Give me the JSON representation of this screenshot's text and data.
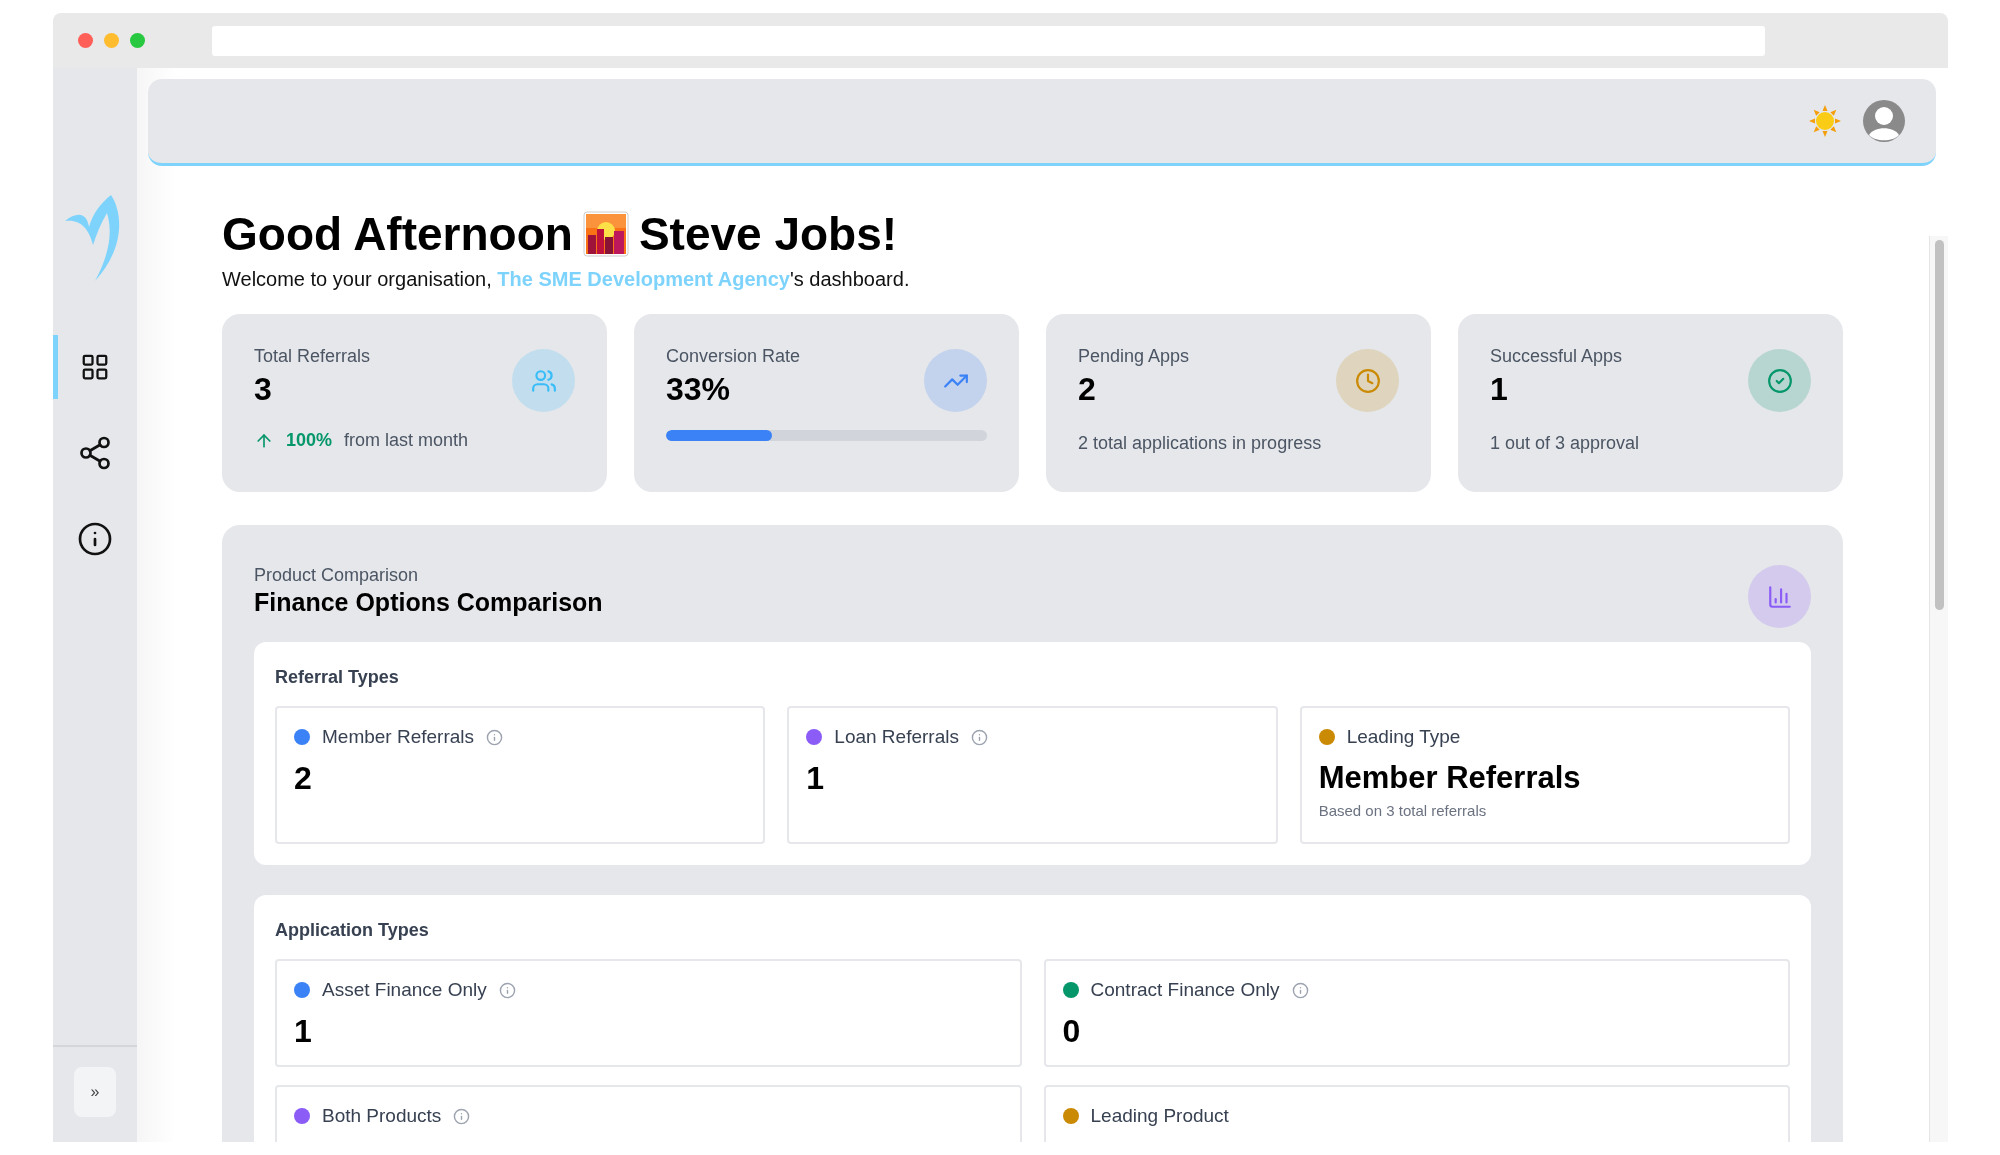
{
  "sidebar": {
    "items": [
      {
        "kind": "grid",
        "selected": true
      },
      {
        "kind": "share",
        "selected": false
      },
      {
        "kind": "info",
        "selected": false
      }
    ],
    "expand_button": "»"
  },
  "greeting": {
    "before": "Good Afternoon",
    "after": "Steve Jobs!",
    "welcome_prefix": "Welcome to your organisation, ",
    "organisation": "The SME Development Agency",
    "welcome_suffix": "'s dashboard."
  },
  "stats": [
    {
      "kind": "trend",
      "label": "Total Referrals",
      "value": "3",
      "color": "#38bdf8",
      "change": "100%",
      "note": "from last month"
    },
    {
      "kind": "progress",
      "label": "Conversion Rate",
      "value": "33%",
      "color": "#3b82f6",
      "level": 0.33
    },
    {
      "kind": "note",
      "label": "Pending Apps",
      "value": "2",
      "color": "#ca8a04",
      "note": "2 total applications in progress"
    },
    {
      "kind": "note",
      "label": "Successful Apps",
      "value": "1",
      "color": "#059669",
      "note": "1 out of 3 approval"
    }
  ],
  "comparison": {
    "eyebrow": "Product Comparison",
    "title": "Finance Options Comparison",
    "sections": [
      {
        "title": "Referral Types",
        "items": [
          {
            "kind": "count",
            "label": "Member Referrals",
            "value": "2",
            "color": "#3b82f6"
          },
          {
            "kind": "count",
            "label": "Loan Referrals",
            "value": "1",
            "color": "#8b5cf6"
          },
          {
            "kind": "leading",
            "label": "Leading Type",
            "value": "Member Referrals",
            "note": "Based on 3 total referrals",
            "color": "#ca8a04"
          }
        ]
      },
      {
        "title": "Application Types",
        "items": [
          {
            "kind": "count",
            "label": "Asset Finance Only",
            "value": "1",
            "color": "#3b82f6"
          },
          {
            "kind": "count",
            "label": "Contract Finance Only",
            "value": "0",
            "color": "#059669"
          },
          {
            "kind": "count",
            "label": "Both Products",
            "color": "#8b5cf6"
          },
          {
            "kind": "leading",
            "label": "Leading Product",
            "color": "#ca8a04"
          }
        ]
      }
    ]
  }
}
